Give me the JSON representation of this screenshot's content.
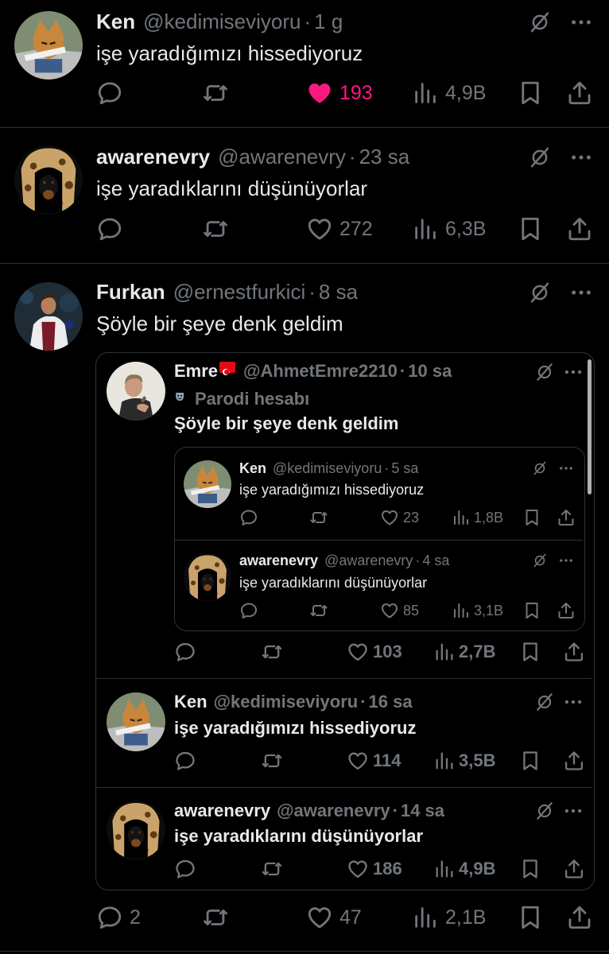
{
  "colors": {
    "bg": "#000000",
    "text": "#e7e9ea",
    "muted": "#71767b",
    "like": "#f91880",
    "border": "#2f3336"
  },
  "tweets": [
    {
      "name": "Ken",
      "handle": "@kedimiseviyoru",
      "time": "1 g",
      "text": "işe yaradığımızı hissediyoruz",
      "likes": "193",
      "liked": true,
      "views": "4,9B"
    },
    {
      "name": "awarenevry",
      "handle": "@awarenevry",
      "time": "23 sa",
      "text": "işe yaradıklarını düşünüyorlar",
      "likes": "272",
      "views": "6,3B"
    },
    {
      "name": "Furkan",
      "handle": "@ernestfurkici",
      "time": "8 sa",
      "text": "Şöyle bir şeye denk geldim",
      "replies": "2",
      "likes": "47",
      "views": "2,1B"
    }
  ],
  "quote": {
    "name": "Emre",
    "handle": "@AhmetEmre2210",
    "time": "10 sa",
    "parody": "Parodi hesabı",
    "text": "Şöyle bir şeye denk geldim",
    "likes": "103",
    "views": "2,7B",
    "inner": [
      {
        "name": "Ken",
        "handle": "@kedimiseviyoru",
        "time": "5 sa",
        "text": "işe yaradığımızı hissediyoruz",
        "likes": "23",
        "views": "1,8B"
      },
      {
        "name": "awarenevry",
        "handle": "@awarenevry",
        "time": "4 sa",
        "text": "işe yaradıklarını düşünüyorlar",
        "likes": "85",
        "views": "3,1B"
      }
    ],
    "following": [
      {
        "name": "Ken",
        "handle": "@kedimiseviyoru",
        "time": "16 sa",
        "text": "işe yaradığımızı hissediyoruz",
        "likes": "114",
        "views": "3,5B"
      },
      {
        "name": "awarenevry",
        "handle": "@awarenevry",
        "time": "14 sa",
        "text": "işe yaradıklarını düşünüyorlar",
        "likes": "186",
        "views": "4,9B"
      }
    ]
  },
  "separator": "·"
}
